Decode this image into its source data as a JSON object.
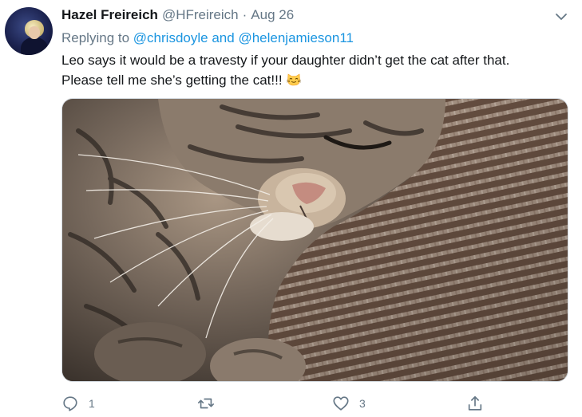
{
  "tweet": {
    "author_name": "Hazel Freireich",
    "handle": "@HFreireich",
    "separator": "·",
    "date": "Aug 26",
    "replying_prefix": "Replying to",
    "reply_user_1": "@chrisdoyle",
    "reply_conjunction": "and",
    "reply_user_2": "@helenjamieson11",
    "text_line_1": "Leo says it would be a travesty if your daughter didn’t get the cat after that.",
    "text_line_2": "Please tell me she’s getting the cat!!!",
    "emoji": "cat-face-emoji"
  },
  "actions": {
    "reply_count": "1",
    "retweet_count": "",
    "like_count": "3"
  },
  "colors": {
    "link": "#1b95e0",
    "secondary": "#657786",
    "primary_text": "#14171a"
  }
}
